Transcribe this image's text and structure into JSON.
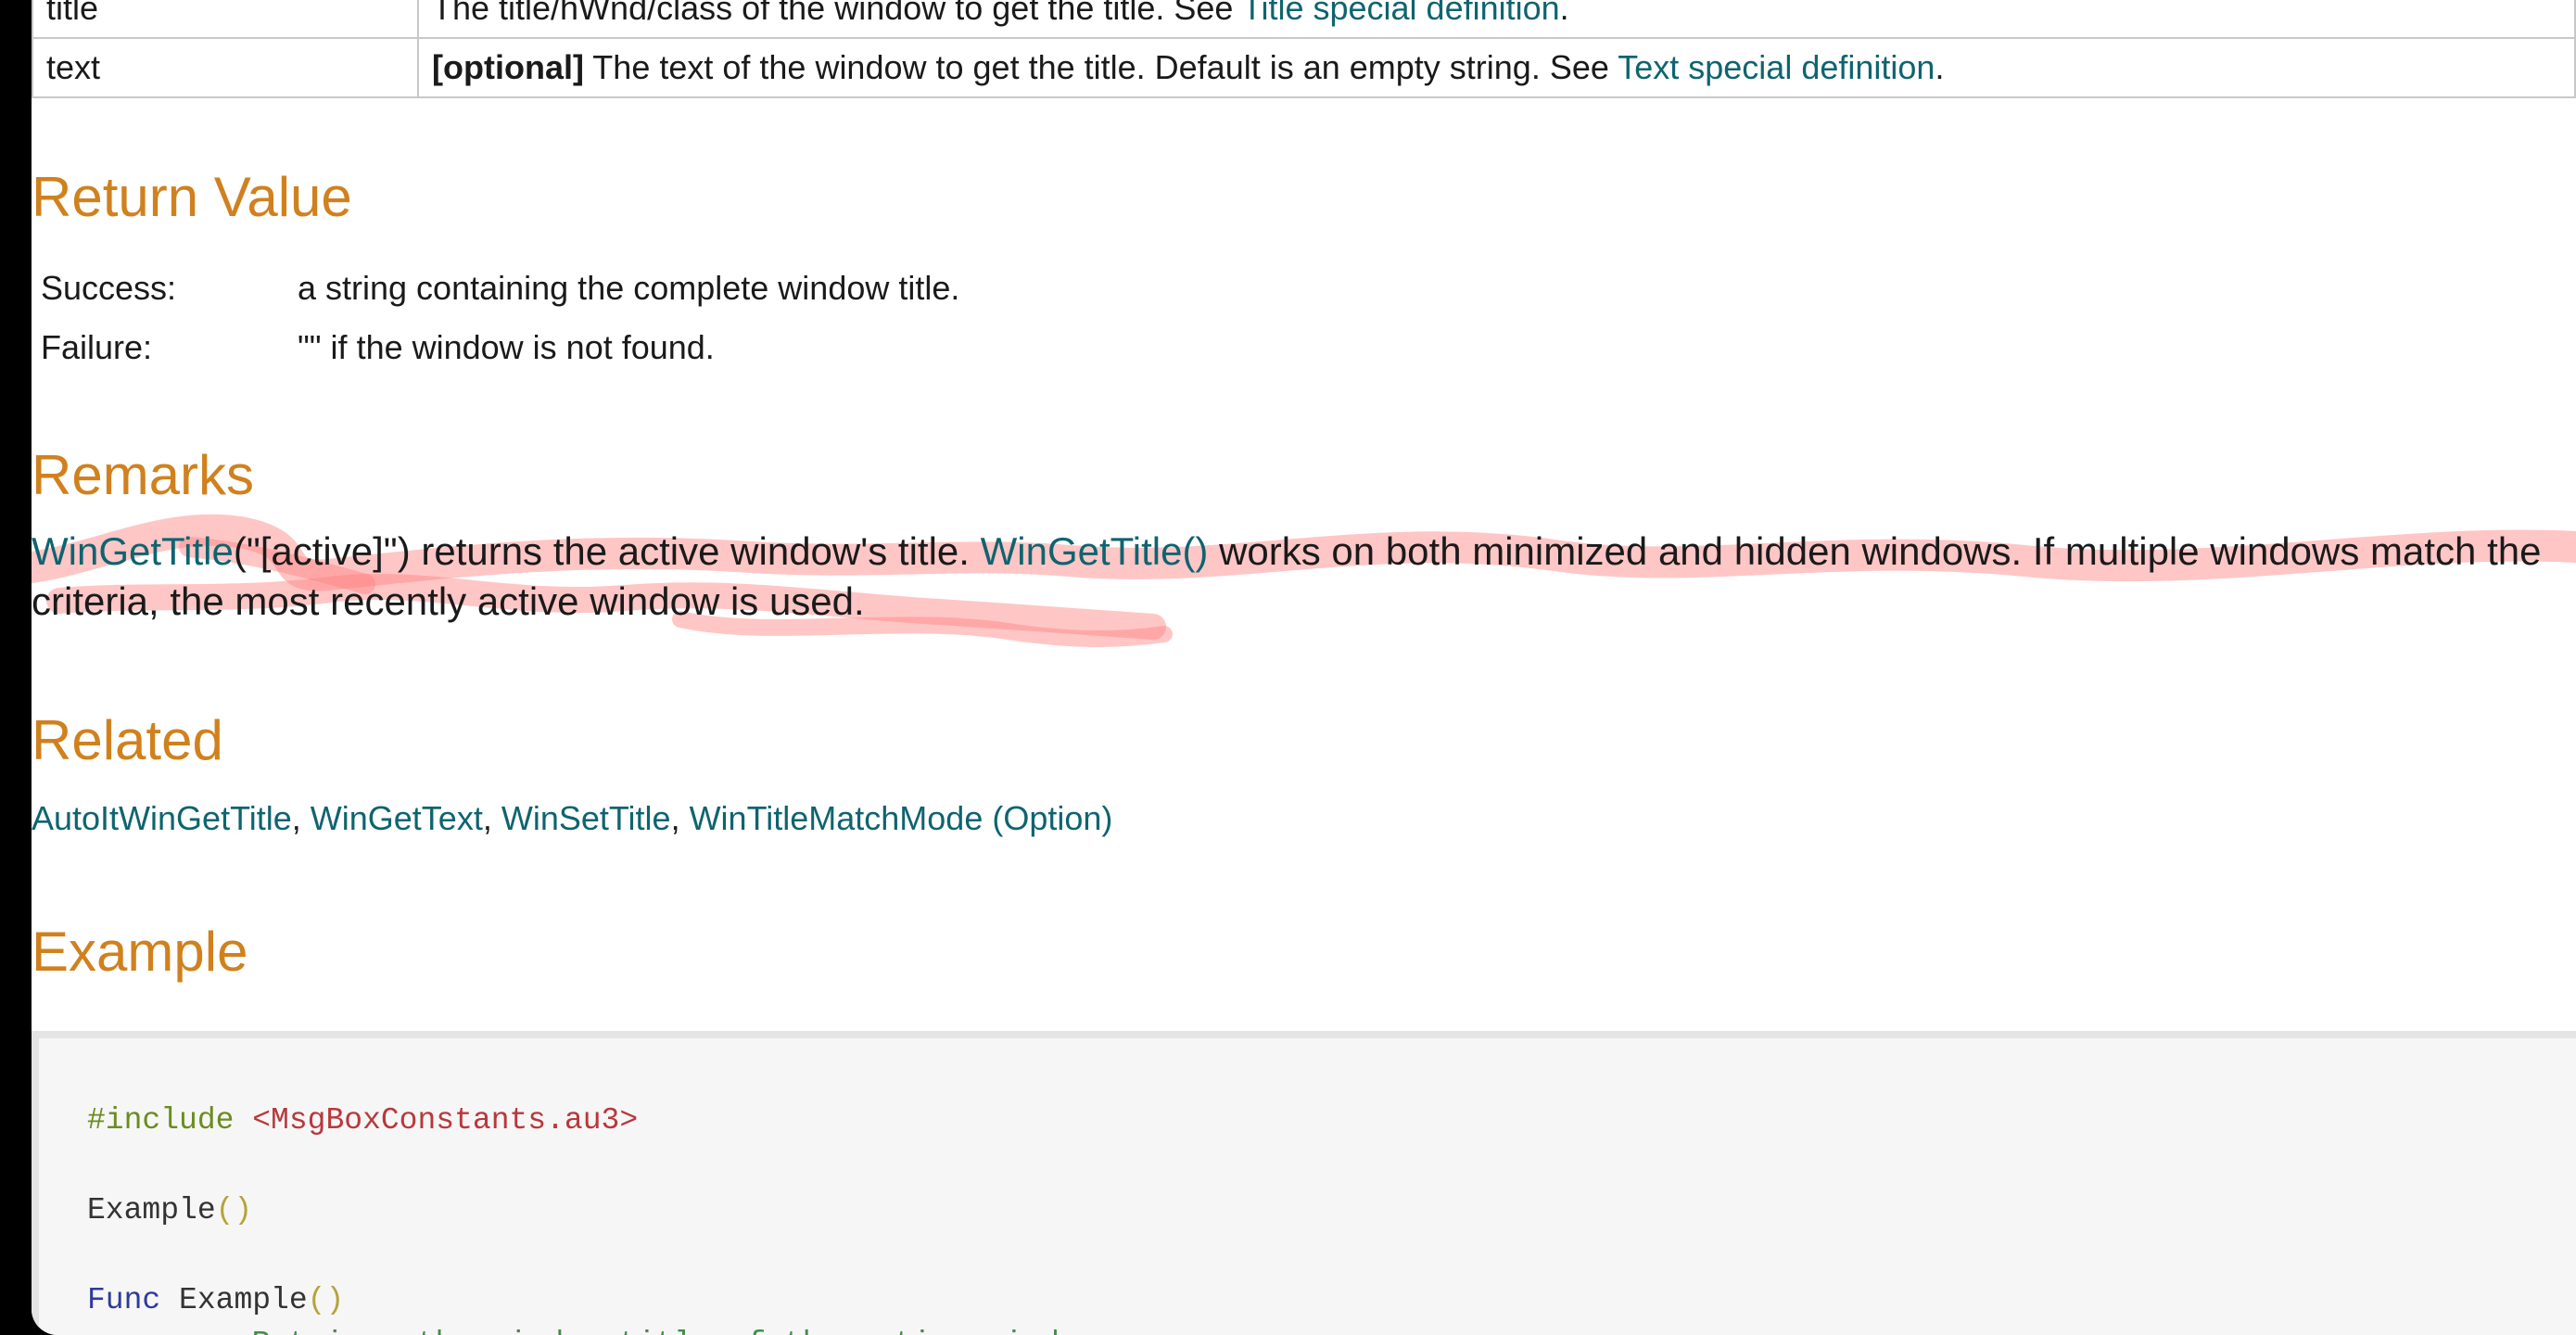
{
  "params": {
    "rows": [
      {
        "name": "title",
        "prefix": "",
        "desc": "The title/hWnd/class of the window to get the title. See ",
        "link": "Title special definition",
        "suffix": "."
      },
      {
        "name": "text",
        "prefix": "[optional]",
        "desc": " The text of the window to get the title. Default is an empty string. See ",
        "link": "Text special definition",
        "suffix": "."
      }
    ]
  },
  "return_value": {
    "heading": "Return Value",
    "rows": [
      {
        "label": "Success:",
        "value": "a string containing the complete window title."
      },
      {
        "label": "Failure:",
        "value": "\"\" if the window is not found."
      }
    ]
  },
  "remarks": {
    "heading": "Remarks",
    "link1": "WinGetTitle",
    "text1": "(\"[active]\") returns the active window's title. ",
    "link2": "WinGetTitle()",
    "text2": " works on both minimized and hidden windows. If multiple windows match the criteria, the most recently active window is used."
  },
  "related": {
    "heading": "Related",
    "links": [
      "AutoItWinGetTitle",
      "WinGetText",
      "WinSetTitle",
      "WinTitleMatchMode (Option)"
    ],
    "separator": ", "
  },
  "example": {
    "heading": "Example",
    "line1_directive": "#include",
    "line1_file": "<MsgBoxConstants.au3>",
    "line2_name": "Example",
    "line2_parens": "()",
    "line3_kw": "Func",
    "line3_name": "Example",
    "line3_parens": "()",
    "line4_comment": "; Retrieve the window title of the active window."
  },
  "colors": {
    "heading": "#d0811e",
    "link": "#0e6470",
    "highlight": "#ff8080"
  }
}
